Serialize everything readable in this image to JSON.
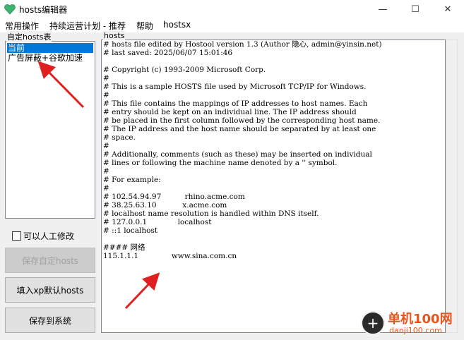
{
  "window": {
    "title": "hosts编辑器",
    "minimize": "—",
    "maximize": "☐",
    "close": "✕"
  },
  "menu": [
    "常用操作",
    "持续运营计划 - 推荐",
    "帮助",
    "hostsx"
  ],
  "sidebar": {
    "group_label": "自定hosts表",
    "items": [
      {
        "label": "当前",
        "selected": true
      },
      {
        "label": "广告屏蔽+谷歌加速",
        "selected": false
      }
    ],
    "checkbox_label": "可以人工修改",
    "checkbox_checked": false,
    "buttons": [
      {
        "label": "保存自定hosts",
        "enabled": false
      },
      {
        "label": "填入xp默认hosts",
        "enabled": true
      },
      {
        "label": "保存到系统",
        "enabled": true
      }
    ]
  },
  "editor": {
    "group_label": "hosts",
    "lines": [
      "# hosts file edited by Hostool version 1.3 (Author 隐心, admin@yinsin.net)",
      "# last saved: 2025/06/07 15:01:46",
      "",
      "# Copyright (c) 1993-2009 Microsoft Corp.",
      "#",
      "# This is a sample HOSTS file used by Microsoft TCP/IP for Windows.",
      "#",
      "# This file contains the mappings of IP addresses to host names. Each",
      "# entry should be kept on an individual line. The IP address should",
      "# be placed in the first column followed by the corresponding host name.",
      "# The IP address and the host name should be separated by at least one",
      "# space.",
      "#",
      "# Additionally, comments (such as these) may be inserted on individual",
      "# lines or following the machine name denoted by a '' symbol.",
      "#",
      "# For example:",
      "#",
      "# 102.54.94.97          rhino.acme.com",
      "# 38.25.63.10           x.acme.com",
      "# localhost name resolution is handled within DNS itself.",
      "# 127.0.0.1             localhost",
      "# ::1 localhost",
      "",
      "#### 网络",
      "115.1.1.1              www.sina.com.cn"
    ]
  },
  "watermark": {
    "icon": "+",
    "main": "单机100网",
    "sub": "danji100.com"
  },
  "colors": {
    "selection": "#0078d7",
    "arrow": "#e02020",
    "watermark": "#e8541c",
    "app_icon": "#3cb371"
  }
}
